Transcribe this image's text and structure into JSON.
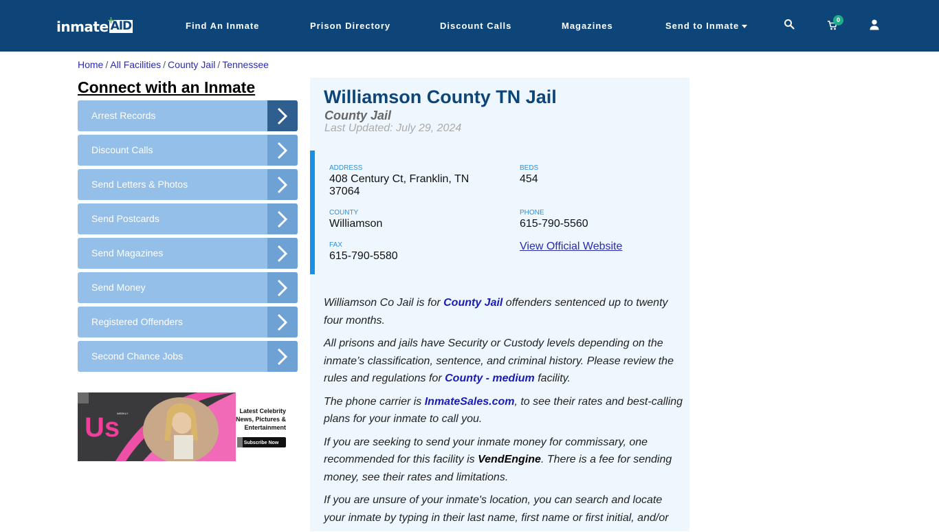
{
  "brand": {
    "logo_left": "inmate",
    "logo_right": "AID",
    "logo_plus": "+"
  },
  "nav": {
    "links": [
      "Find An Inmate",
      "Prison Directory",
      "Discount Calls",
      "Magazines",
      "Send to Inmate"
    ],
    "cart_count": "0",
    "icons": [
      "search-icon",
      "cart-icon",
      "user-icon"
    ]
  },
  "breadcrumb": [
    "Home",
    "All Facilities",
    "County Jail",
    "Tennessee"
  ],
  "sidebar": {
    "title": "Connect with an Inmate",
    "items": [
      {
        "label": "Arrest Records"
      },
      {
        "label": "Discount Calls"
      },
      {
        "label": "Send Letters & Photos"
      },
      {
        "label": "Send Postcards"
      },
      {
        "label": "Send Magazines"
      },
      {
        "label": "Send Money"
      },
      {
        "label": "Registered Offenders"
      },
      {
        "label": "Second Chance Jobs"
      }
    ],
    "ad": {
      "brand": "Us",
      "brand_tag": "WEEKLY",
      "headline_lines": [
        "Latest Celebrity",
        "News, Pictures &",
        "Entertainment"
      ],
      "cta": "Subscribe Now"
    }
  },
  "facility": {
    "title": "Williamson County TN Jail",
    "type": "County Jail",
    "updated": "Last Updated: July 29, 2024",
    "fields": {
      "address_label": "ADDRESS",
      "address_line1": "408 Century Ct, Franklin, TN",
      "address_line2": "37064",
      "beds_label": "BEDS",
      "beds": "454",
      "county_label": "COUNTY",
      "county": "Williamson",
      "phone_label": "PHONE",
      "phone": "615-790-5560",
      "fax_label": "FAX",
      "fax": "615-790-5580",
      "website_link": "View Official Website"
    },
    "paragraphs": {
      "p1_a": "Williamson Co Jail is for ",
      "p1_link": "County Jail",
      "p1_b": " offenders sentenced up to twenty four months.",
      "p2_a": "All prisons and jails have Security or Custody levels depending on the inmate’s classification, sentence, and criminal history. Please review the rules and regulations for ",
      "p2_link": "County - medium",
      "p2_b": " facility.",
      "p3_a": "The phone carrier is ",
      "p3_link": "InmateSales.com",
      "p3_b": ", to see their rates and best-calling plans for your inmate to call you.",
      "p4_a": "If you are seeking to send your inmate money for commissary, one recommended for this facility is ",
      "p4_bold": "VendEngine",
      "p4_b": ". There is a fee for sending money, see their rates and limitations.",
      "p5": "If you are unsure of your inmate's location, you can search and locate your inmate by typing in their last name, first name or first initial, and/or"
    }
  }
}
